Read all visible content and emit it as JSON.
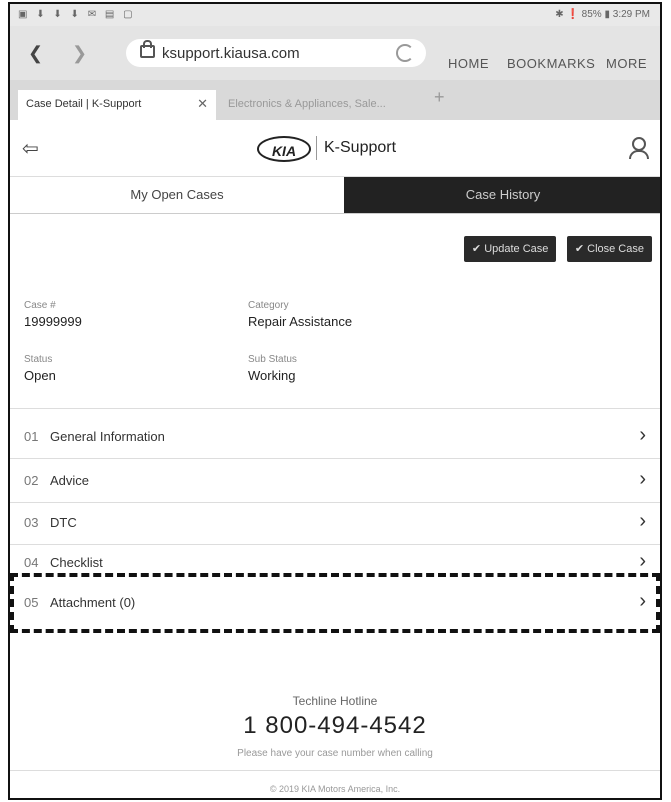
{
  "status_bar": {
    "left": "▣ ⬇ ⬇ ⬇ ✉ ▤ ▢",
    "right": "✱ ❗ 85% ▮ 3:29 PM"
  },
  "browser": {
    "url": "ksupport.kiausa.com",
    "menu": [
      "HOME",
      "BOOKMARKS",
      "MORE"
    ],
    "tabs": [
      {
        "label": "Case Detail | K-Support",
        "active": true
      },
      {
        "label": "Electronics & Appliances, Sale...",
        "active": false
      }
    ]
  },
  "header": {
    "logo": "KIA",
    "brand": "K-Support"
  },
  "case_tabs": [
    "My Open Cases",
    "Case History"
  ],
  "actions": {
    "update": "✔ Update Case",
    "close": "✔ Close Case"
  },
  "fields": {
    "case_no_label": "Case #",
    "case_no": "19999999",
    "category_label": "Category",
    "category": "Repair Assistance",
    "status_label": "Status",
    "status": "Open",
    "substatus_label": "Sub Status",
    "substatus": "Working"
  },
  "sections": [
    {
      "num": "01",
      "title": "General Information"
    },
    {
      "num": "02",
      "title": "Advice"
    },
    {
      "num": "03",
      "title": "DTC"
    },
    {
      "num": "04",
      "title": "Checklist"
    },
    {
      "num": "05",
      "title": "Attachment (0)"
    }
  ],
  "footer": {
    "hotline_label": "Techline Hotline",
    "hotline_number": "1 800-494-4542",
    "hotline_note": "Please have your case number when calling",
    "copyright": "© 2019 KIA Motors America, Inc."
  }
}
